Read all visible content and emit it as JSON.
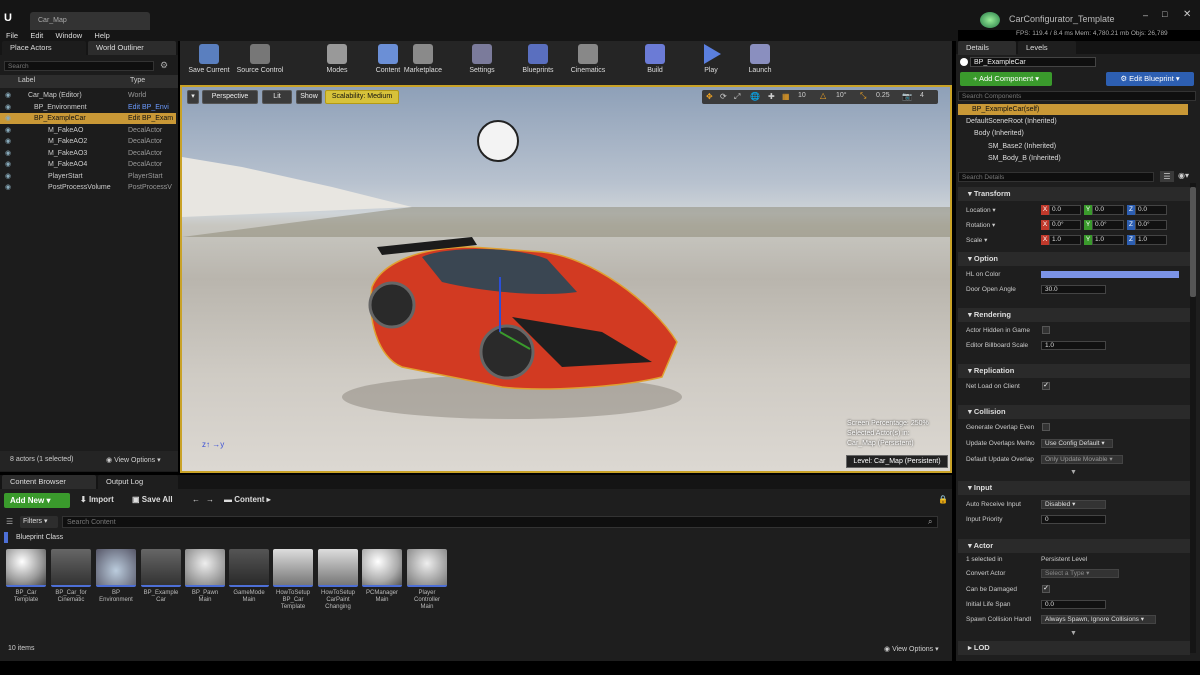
{
  "window": {
    "title": "CarConfigurator_Template",
    "tab": "Car_Map",
    "stats": {
      "fps": "FPS: 119.4",
      "ms": "/ 8.4 ms",
      "mem": "Mem: 4,780.21 mb",
      "objs": "Objs: 26,789"
    }
  },
  "menu": [
    "File",
    "Edit",
    "Window",
    "Help"
  ],
  "left_tabs": {
    "place": "Place Actors",
    "outliner": "World Outliner"
  },
  "outliner": {
    "search_placeholder": "Search",
    "col_label": "Label",
    "col_type": "Type",
    "rows": [
      {
        "label": "Car_Map (Editor)",
        "type": "World"
      },
      {
        "label": "BP_Environment",
        "type": "Edit BP_Envi"
      },
      {
        "label": "BP_ExampleCar",
        "type": "Edit BP_Exam"
      },
      {
        "label": "M_FakeAO",
        "type": "DecalActor"
      },
      {
        "label": "M_FakeAO2",
        "type": "DecalActor"
      },
      {
        "label": "M_FakeAO3",
        "type": "DecalActor"
      },
      {
        "label": "M_FakeAO4",
        "type": "DecalActor"
      },
      {
        "label": "PlayerStart",
        "type": "PlayerStart"
      },
      {
        "label": "PostProcessVolume",
        "type": "PostProcessV"
      }
    ],
    "footer": "8 actors (1 selected)",
    "view_options": "View Options"
  },
  "toolbar": [
    "Save Current",
    "Source Control",
    "Modes",
    "Content",
    "Marketplace",
    "Settings",
    "Blueprints",
    "Cinematics",
    "Build",
    "Play",
    "Launch"
  ],
  "viewport": {
    "perspective": "Perspective",
    "lit": "Lit",
    "show": "Show",
    "scalability": "Scalability: Medium",
    "grid": "10",
    "angle": "10°",
    "scale": "0.25",
    "cam": "4",
    "overlay": [
      "Screen Percentage: 250%",
      "Selected Actor(s) in:",
      "Car_Map (Persistent)"
    ],
    "level": "Level:  Car_Map (Persistent)"
  },
  "bottom_tabs": {
    "content": "Content Browser",
    "output": "Output Log"
  },
  "content": {
    "add_new": "Add New",
    "import": "Import",
    "save_all": "Save All",
    "path": "Content",
    "filters": "Filters",
    "search_placeholder": "Search Content",
    "class": "Blueprint Class",
    "assets": [
      "BP_Car\nTemplate",
      "BP_Car_for\nCinematic",
      "BP\nEnvironment",
      "BP_Example\nCar",
      "BP_Pawn\nMain",
      "GameMode\nMain",
      "HowToSetup\nBP_Car\nTemplate",
      "HowToSetup\nCarPaint\nChanging",
      "PCManager\nMain",
      "Player\nController\nMain"
    ],
    "footer": "10 items",
    "view_options": "View Options"
  },
  "details": {
    "tab_details": "Details",
    "tab_levels": "Levels",
    "actor": "BP_ExampleCar",
    "add_component": "+ Add Component",
    "edit_blueprint": "Edit Blueprint",
    "search_components": "Search Components",
    "components": [
      "BP_ExampleCar(self)",
      "DefaultSceneRoot (Inherited)",
      "Body (Inherited)",
      "SM_Base2 (Inherited)",
      "SM_Body_B (Inherited)"
    ],
    "search_details": "Search Details",
    "transform": {
      "title": "Transform",
      "location": "Location",
      "rotation": "Rotation",
      "scale": "Scale",
      "loc": [
        "0.0",
        "0.0",
        "0.0"
      ],
      "rot": [
        "0.0°",
        "0.0°",
        "0.0°"
      ],
      "scl": [
        "1.0",
        "1.0",
        "1.0"
      ]
    },
    "option": {
      "title": "Option",
      "hl_color": "HL on Color",
      "hl_color_value": "#7b93e6",
      "door": "Door Open Angle",
      "door_value": "30.0"
    },
    "rendering": {
      "title": "Rendering",
      "hidden": "Actor Hidden in Game",
      "billboard": "Editor Billboard Scale",
      "billboard_value": "1.0"
    },
    "replication": {
      "title": "Replication",
      "net_load": "Net Load on Client"
    },
    "collision": {
      "title": "Collision",
      "gen_overlap": "Generate Overlap Even",
      "update_overlaps": "Update Overlaps Metho",
      "update_value": "Use Config Default",
      "default_update": "Default Update Overlap",
      "default_value": "Only Update Movable"
    },
    "input": {
      "title": "Input",
      "auto_receive": "Auto Receive Input",
      "auto_value": "Disabled",
      "priority": "Input Priority",
      "priority_value": "0"
    },
    "actor_sec": {
      "title": "Actor",
      "selected_in": "1 selected in",
      "selected_value": "Persistent Level",
      "convert": "Convert Actor",
      "convert_value": "Select a Type",
      "damaged": "Can be Damaged",
      "lifespan": "Initial Life Span",
      "lifespan_value": "0.0",
      "spawn": "Spawn Collision Handl",
      "spawn_value": "Always Spawn, Ignore Collisions"
    },
    "lod": "LOD"
  },
  "colors": {
    "accent": "#f5a623",
    "blue": "#4d6fd6",
    "green": "#3a9a2c"
  }
}
